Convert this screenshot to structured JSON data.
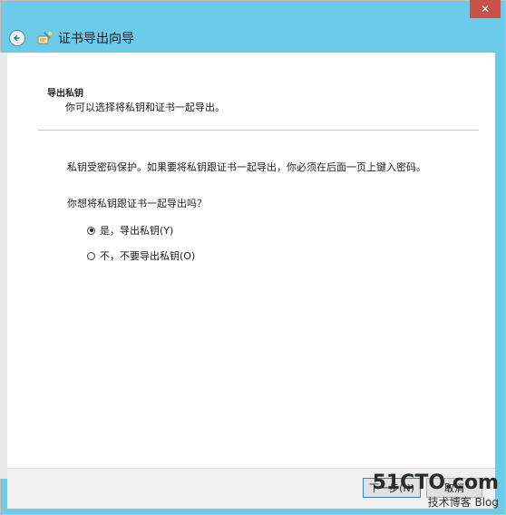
{
  "window": {
    "title": "证书导出向导",
    "close_label": "✕"
  },
  "page": {
    "header_title": "导出私钥",
    "header_subtitle": "你可以选择将私钥和证书一起导出。",
    "description": "私钥受密码保护。如果要将私钥跟证书一起导出，你必须在后面一页上键入密码。",
    "question": "你想将私钥跟证书一起导出吗？"
  },
  "options": [
    {
      "label": "是，导出私钥(Y)",
      "selected": true
    },
    {
      "label": "不，不要导出私钥(O)",
      "selected": false
    }
  ],
  "footer": {
    "next_label": "下一步(N)",
    "cancel_label": "取消"
  },
  "watermark": {
    "line1": "51CTO.com",
    "line2": "技术博客 Blog"
  },
  "colors": {
    "titlebar": "#6ccbe8",
    "close": "#c7524a"
  },
  "icons": {
    "back": "back-arrow-icon",
    "wizard": "certificate-wizard-icon"
  }
}
